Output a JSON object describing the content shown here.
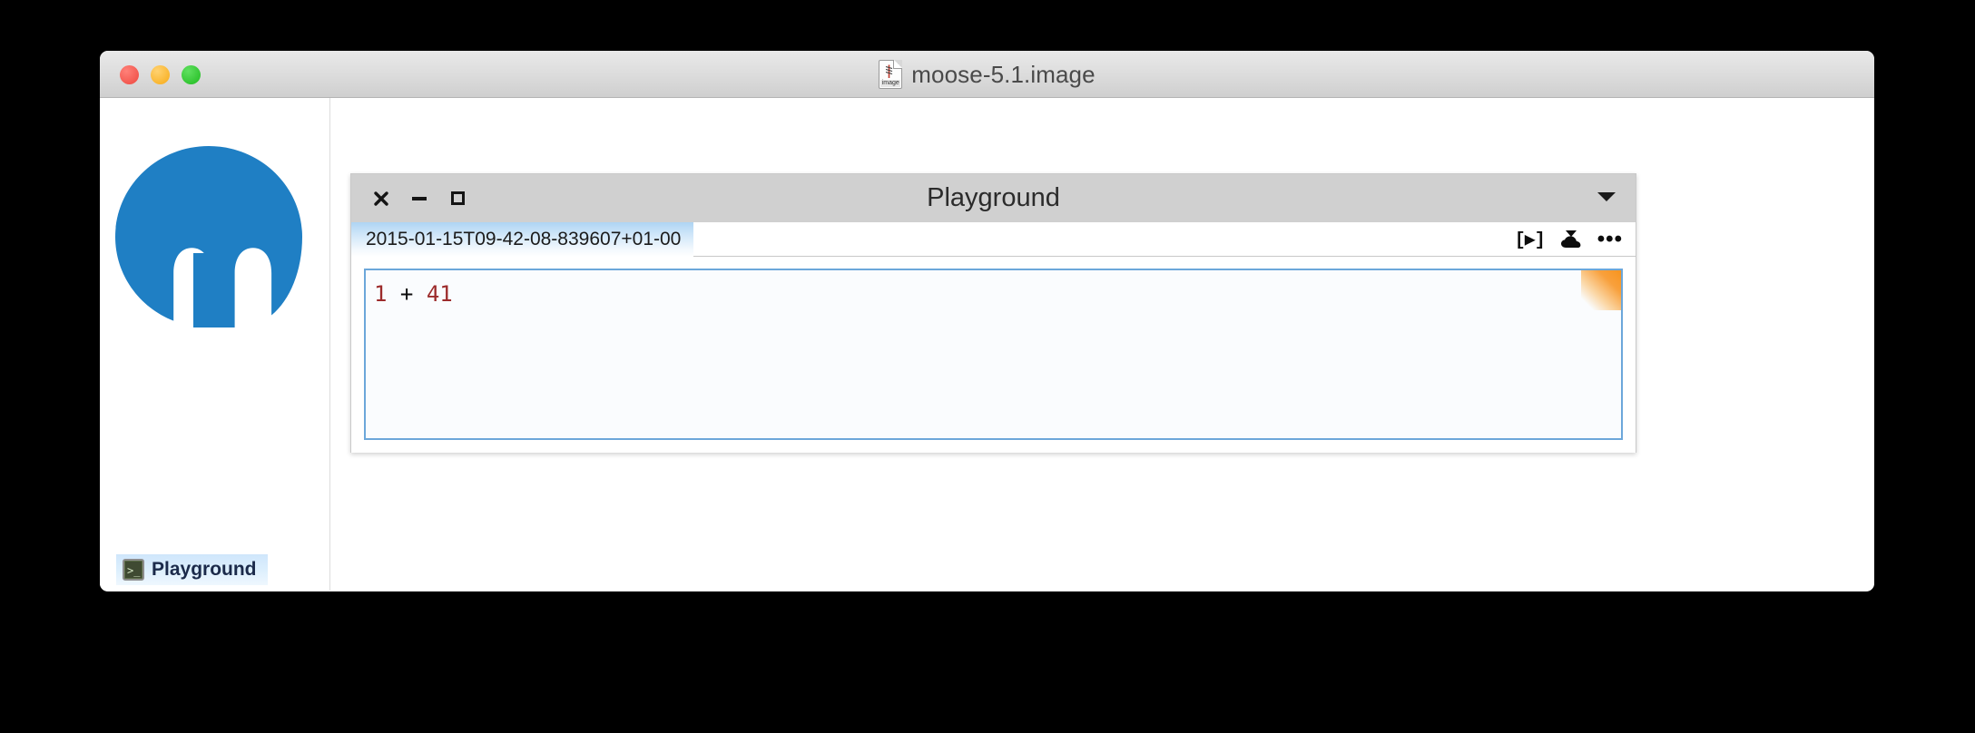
{
  "os_window": {
    "title": "moose-5.1.image",
    "document_icon_label": "image",
    "traffic_lights": [
      {
        "name": "close",
        "color": "#f2564d"
      },
      {
        "name": "minimize",
        "color": "#f9b42c"
      },
      {
        "name": "maximize",
        "color": "#2fc42f"
      }
    ]
  },
  "desktop": {
    "logo_name": "moose-logo",
    "logo_color": "#1f7fc4",
    "background": "#ffffff"
  },
  "playground": {
    "title": "Playground",
    "window_controls": {
      "close": "✖",
      "minimize": "—",
      "maximize": "□"
    },
    "menu_arrow_icon": "chevron-down-icon",
    "tab": {
      "label": "2015-01-15T09-42-08-839607+01-00",
      "active": true
    },
    "tools": [
      {
        "name": "do-it-button",
        "label": "[▶]"
      },
      {
        "name": "publish-to-cloud-button",
        "label": ""
      },
      {
        "name": "more-options-button",
        "label": "•••"
      }
    ],
    "editor": {
      "code_tokens": [
        {
          "text": "1",
          "type": "number"
        },
        {
          "text": " + ",
          "type": "operator"
        },
        {
          "text": "41",
          "type": "number"
        }
      ],
      "code_plain": "1 + 41",
      "unsaved_marker": "orange-corner-triangle",
      "border_color": "#6ca7da",
      "number_color": "#9c2b2b",
      "unsaved_color": "#f7941e"
    }
  },
  "taskbar": {
    "items": [
      {
        "label": "Playground",
        "icon": "terminal-icon",
        "prompt": ">_"
      }
    ]
  }
}
